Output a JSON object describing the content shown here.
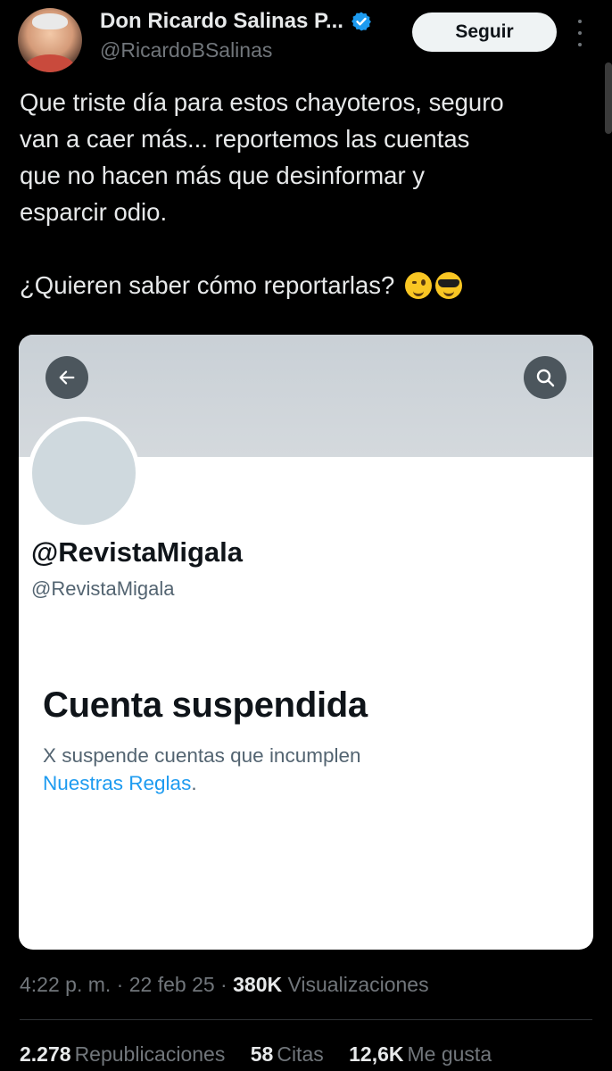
{
  "author": {
    "display_name": "Don Ricardo Salinas P...",
    "handle": "@RicardoBSalinas",
    "verified": true,
    "avatar_icon": "profile-photo"
  },
  "actions": {
    "follow_label": "Seguir",
    "more_icon": "more-vertical-icon"
  },
  "tweet": {
    "lines": [
      "Que triste día para estos chayoteros, seguro",
      "van a caer más... reportemos las cuentas",
      "que no hacen más que desinformar y",
      "esparcir odio."
    ],
    "question": "¿Quieren saber cómo reportarlas?",
    "emojis": [
      "winking-face",
      "smiling-face-with-sunglasses"
    ]
  },
  "embedded_card": {
    "back_icon": "arrow-left-icon",
    "search_icon": "search-icon",
    "profile_name": "@RevistaMigala",
    "profile_handle": "@RevistaMigala",
    "status_title": "Cuenta suspendida",
    "status_text": "X suspende cuentas que incumplen",
    "status_link": "Nuestras Reglas",
    "status_suffix": ".",
    "colors": {
      "link": "#1d9bf0",
      "banner": "#cdd4d9"
    }
  },
  "meta": {
    "time": "4:22 p. m.",
    "sep1": "·",
    "date": "22 feb 25",
    "sep2": "·",
    "views_count": "380K",
    "views_label": "Visualizaciones"
  },
  "stats": [
    {
      "count": "2.278",
      "label": "Republicaciones"
    },
    {
      "count": "58",
      "label": "Citas"
    },
    {
      "count": "12,6K",
      "label": "Me gusta"
    }
  ],
  "colors": {
    "background": "#000000",
    "text": "#e7e9ea",
    "muted": "#71767b",
    "verified": "#1d9bf0"
  }
}
